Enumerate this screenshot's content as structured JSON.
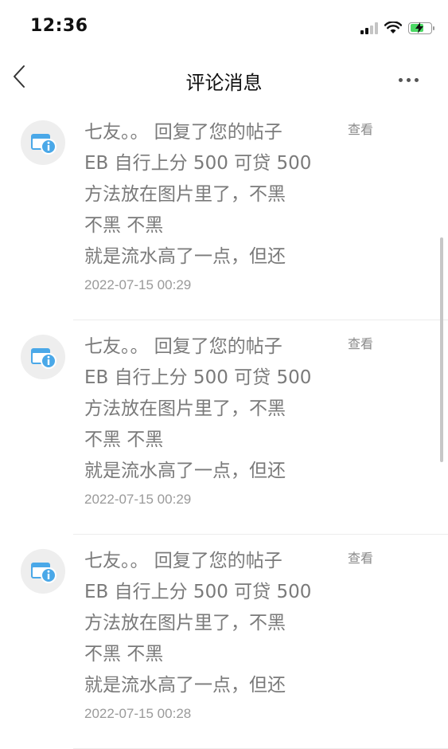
{
  "status_bar": {
    "time": "12:36",
    "signal_bars": 2,
    "battery_percent": 70
  },
  "nav": {
    "title": "评论消息"
  },
  "comments": [
    {
      "lines": [
        "七友。。 回复了您的帖子",
        "EB 自行上分 500 可贷 500",
        "方法放在图片里了，不黑",
        "不黑 不黑",
        "就是流水高了一点，但还"
      ],
      "time": "2022-07-15 00:29",
      "view_label": "查看"
    },
    {
      "lines": [
        "七友。。 回复了您的帖子",
        "EB 自行上分 500 可贷 500",
        "方法放在图片里了，不黑",
        "不黑 不黑",
        "就是流水高了一点，但还"
      ],
      "time": "2022-07-15 00:29",
      "view_label": "查看"
    },
    {
      "lines": [
        "七友。。 回复了您的帖子",
        "EB 自行上分 500 可贷 500",
        "方法放在图片里了，不黑",
        "不黑 不黑",
        "就是流水高了一点，但还"
      ],
      "time": "2022-07-15 00:28",
      "view_label": "查看"
    }
  ],
  "icons": {
    "back": "chevron-left-icon",
    "more": "more-horizontal-icon",
    "avatar": "info-window-icon"
  },
  "colors": {
    "avatar_icon": "#4aa8e8",
    "battery_fill": "#4cd964"
  }
}
